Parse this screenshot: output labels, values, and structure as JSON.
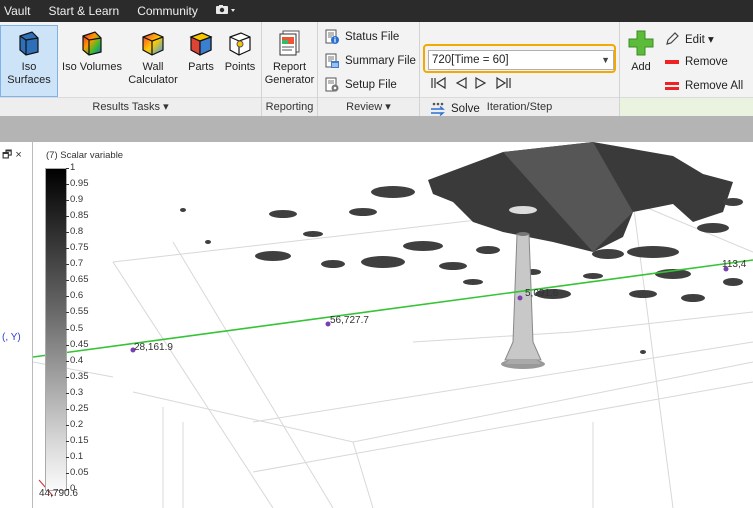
{
  "menu": {
    "items": [
      "Vault",
      "Start & Learn",
      "Community"
    ],
    "camera_icon": "camera-icon"
  },
  "ribbon": {
    "results_tasks": {
      "label": "Results Tasks ▾",
      "buttons": [
        {
          "label": "Iso Surfaces",
          "icon": "iso-surfaces-icon",
          "active": true
        },
        {
          "label": "Iso Volumes",
          "icon": "iso-volumes-icon"
        },
        {
          "label": "Wall Calculator",
          "icon": "wall-calculator-icon"
        },
        {
          "label": "Parts",
          "icon": "parts-icon"
        },
        {
          "label": "Points",
          "icon": "points-icon"
        }
      ]
    },
    "reporting": {
      "label": "Reporting",
      "button": "Report Generator"
    },
    "review": {
      "label": "Review ▾",
      "items": [
        "Status File",
        "Summary File",
        "Setup File"
      ]
    },
    "iteration": {
      "label": "Iteration/Step",
      "selected": "720[Time = 60]",
      "solve": "Solve"
    },
    "edit_group": {
      "add": "Add",
      "edit": "Edit ▾",
      "remove": "Remove",
      "remove_all": "Remove All"
    }
  },
  "panel": {
    "controls": "🗗 ×",
    "axis_hint": "(, Y)"
  },
  "viewport": {
    "legend": {
      "title": "(7) Scalar variable",
      "ticks": [
        "1",
        "0.95",
        "0.9",
        "0.85",
        "0.8",
        "0.75",
        "0.7",
        "0.65",
        "0.6",
        "0.55",
        "0.5",
        "0.45",
        "0.4",
        "0.35",
        "0.3",
        "0.25",
        "0.2",
        "0.15",
        "0.1",
        "0.05",
        "0"
      ]
    },
    "probe_labels": [
      "28,161.9",
      "56,727.7",
      "5,091.6",
      "113,4",
      "44,790.6"
    ],
    "colors": {
      "probe_line": "#35c435",
      "probe_point": "#7a3fb5",
      "highlight": "#f2a900",
      "active_button": "#cde3f7"
    }
  }
}
